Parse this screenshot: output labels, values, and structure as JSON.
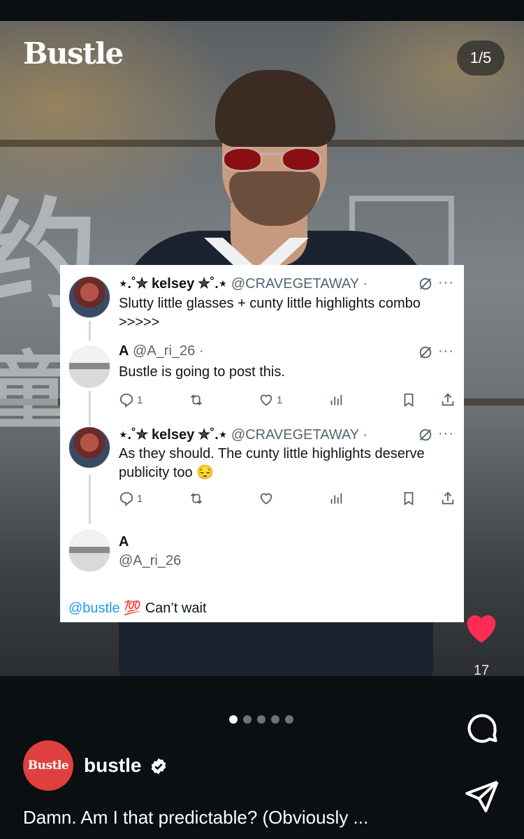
{
  "brand": {
    "logo_text": "Bustle"
  },
  "carousel": {
    "counter": "1/5",
    "total_dots": 5,
    "active_dot": 1
  },
  "tweets": [
    {
      "name": "⋆.˚✮ kelsey ✮˚.⋆",
      "handle": "@CRAVEGETAWAY",
      "separator": "·",
      "text": "Slutty little glasses + cunty little highlights combo >>>>>"
    },
    {
      "name": "A",
      "handle": "@A_ri_26",
      "separator": "·",
      "text": "Bustle is going to post this.",
      "replies": "1",
      "likes": "1"
    },
    {
      "name": "⋆.˚✮ kelsey ✮˚.⋆",
      "handle": "@CRAVEGETAWAY",
      "separator": "·",
      "text": "As they should. The cunty little highlights deserve publicity too 😔",
      "replies": "1"
    },
    {
      "name": "A",
      "handle": "@A_ri_26",
      "mention": "@bustle",
      "emoji": "💯",
      "text": " Can’t wait"
    }
  ],
  "more_label": "···",
  "post": {
    "like_count": "17",
    "account_avatar_text": "Bustle",
    "account_name": "bustle",
    "caption": "Damn. Am I that predictable? (Obviously ..."
  },
  "colors": {
    "heart": "#fe2c55",
    "mention": "#1d9bf0",
    "account_avatar": "#e0403d"
  },
  "icons": [
    "grok-icon",
    "reply-icon",
    "retweet-icon",
    "like-icon",
    "views-icon",
    "bookmark-icon",
    "share-icon",
    "heart-icon",
    "comment-icon",
    "send-icon",
    "verified-icon"
  ]
}
